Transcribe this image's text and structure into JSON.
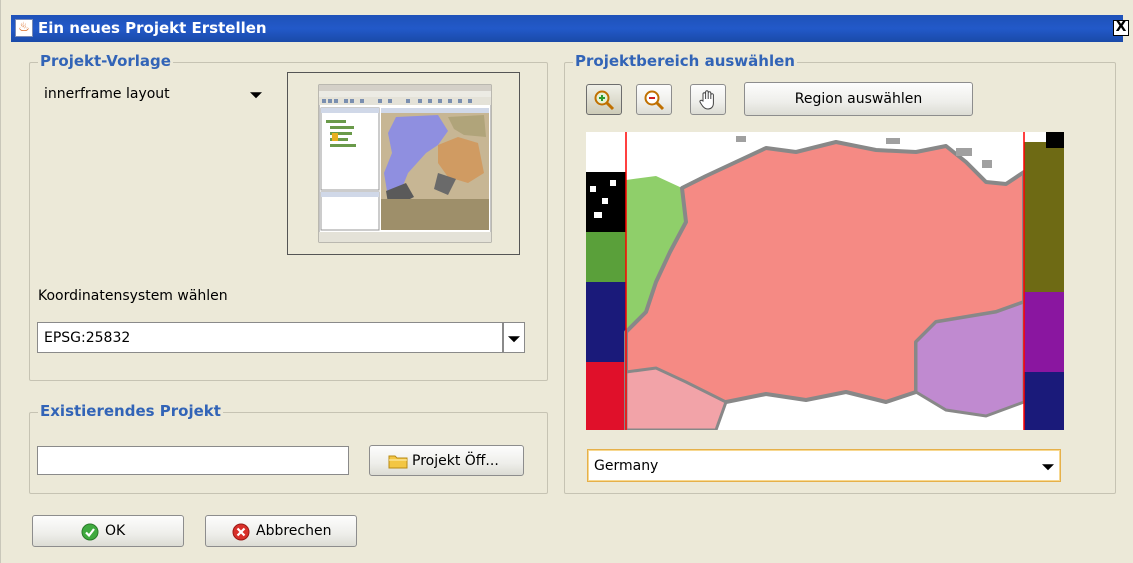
{
  "window": {
    "title": "Ein neues Projekt Erstellen",
    "close_symbol": "X"
  },
  "template_group": {
    "legend": "Projekt-Vorlage",
    "template_select": {
      "value": "innerframe layout"
    },
    "preview_icon": "template-preview-thumbnail",
    "crs_label": "Koordinatensystem wählen",
    "crs_select": {
      "value": "EPSG:25832"
    }
  },
  "existing_group": {
    "legend": "Existierendes Projekt",
    "path_input": {
      "value": ""
    },
    "open_button": "Projekt Öff..."
  },
  "area_group": {
    "legend": "Projektbereich auswählen",
    "tools": [
      "zoom-in-icon",
      "zoom-out-icon",
      "pan-hand-icon"
    ],
    "region_button": "Region auswählen",
    "region_select": {
      "value": "Germany"
    },
    "map_colors": {
      "main": "#f58a84",
      "west": "#8fcf6a",
      "northwest": "#5aa03a",
      "navy": "#1a1a7a",
      "red": "#e0102a",
      "violet": "#c08ad0",
      "olive": "#6e6a14",
      "purple": "#8a16a0",
      "border": "#888888",
      "selection": "#ff0000"
    }
  },
  "footer": {
    "ok_button": "OK",
    "cancel_button": "Abbrechen",
    "ok_color": "#3faa3f",
    "cancel_color": "#d8302a"
  }
}
